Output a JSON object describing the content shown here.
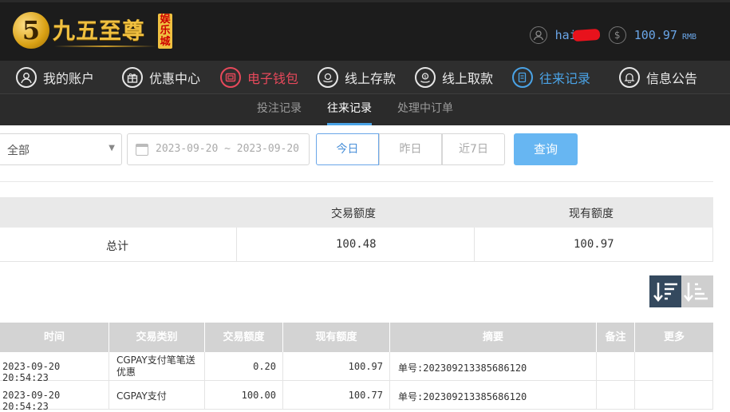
{
  "brand": {
    "logo_mark": "5",
    "name": "九五至尊",
    "tag": "娱乐城"
  },
  "user": {
    "username": "hai",
    "balance": "100.97",
    "currency": "RMB"
  },
  "nav": [
    {
      "label": "我的账户",
      "icon": "user-icon"
    },
    {
      "label": "优惠中心",
      "icon": "gift-icon"
    },
    {
      "label": "电子钱包",
      "icon": "wallet-icon",
      "state": "highlight"
    },
    {
      "label": "线上存款",
      "icon": "deposit-icon"
    },
    {
      "label": "线上取款",
      "icon": "withdraw-icon"
    },
    {
      "label": "往来记录",
      "icon": "records-icon",
      "state": "active"
    },
    {
      "label": "信息公告",
      "icon": "bell-icon"
    }
  ],
  "subtabs": [
    {
      "label": "投注记录"
    },
    {
      "label": "往来记录",
      "active": true
    },
    {
      "label": "处理中订单"
    }
  ],
  "filter": {
    "type_value": "全部",
    "date_range": "2023-09-20 ~ 2023-09-20",
    "quick": [
      "今日",
      "昨日",
      "近7日"
    ],
    "search_label": "查询"
  },
  "summary": {
    "headers": [
      "交易额度",
      "现有额度"
    ],
    "row_label": "总计",
    "amount": "100.48",
    "current": "100.97"
  },
  "table": {
    "headers": [
      "时间",
      "交易类别",
      "交易额度",
      "现有额度",
      "摘要",
      "备注",
      "更多"
    ],
    "rows": [
      {
        "time": "2023-09-20 20:54:23",
        "category": "CGPAY支付笔笔送优惠",
        "amount": "0.20",
        "current": "100.97",
        "summary": "单号:202309213385686120",
        "note": "",
        "more": ""
      },
      {
        "time": "2023-09-20 20:54:23",
        "category": "CGPAY支付",
        "amount": "100.00",
        "current": "100.77",
        "summary": "单号:202309213385686120",
        "note": "",
        "more": ""
      }
    ]
  },
  "colors": {
    "accent": "#4aa3e6",
    "highlight": "#e8495b",
    "search": "#67b6f2",
    "sort_active": "#34495e"
  }
}
